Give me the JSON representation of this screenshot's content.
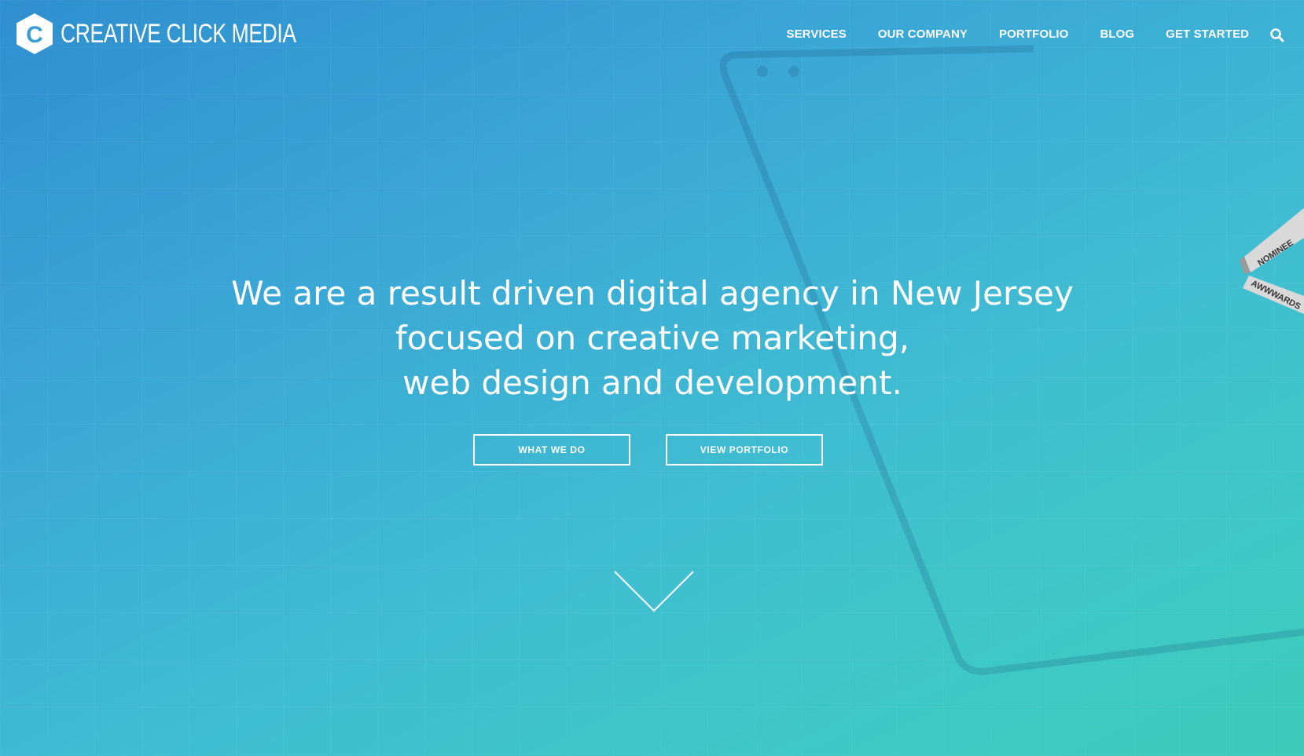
{
  "brand": {
    "logo_letter": "C",
    "name": "CREATIVE CLICK MEDIA"
  },
  "nav": {
    "items": [
      {
        "label": "SERVICES"
      },
      {
        "label": "OUR COMPANY"
      },
      {
        "label": "PORTFOLIO"
      },
      {
        "label": "BLOG"
      },
      {
        "label": "GET STARTED"
      }
    ],
    "search_icon": "search-icon"
  },
  "hero": {
    "headline_lines": [
      "We are a result driven digital agency in New Jersey",
      "focused on creative marketing,",
      "web design and development."
    ],
    "buttons": {
      "what_we_do": "WHAT WE DO",
      "view_portfolio": "VIEW PORTFOLIO"
    },
    "scroll_icon": "chevron-down-icon"
  },
  "award": {
    "line1": "NOMINEE",
    "line2": "AWWWARDS"
  },
  "colors": {
    "gradient_start": "#2f8fcf",
    "gradient_end": "#3ccbb8",
    "text": "#ffffff"
  }
}
